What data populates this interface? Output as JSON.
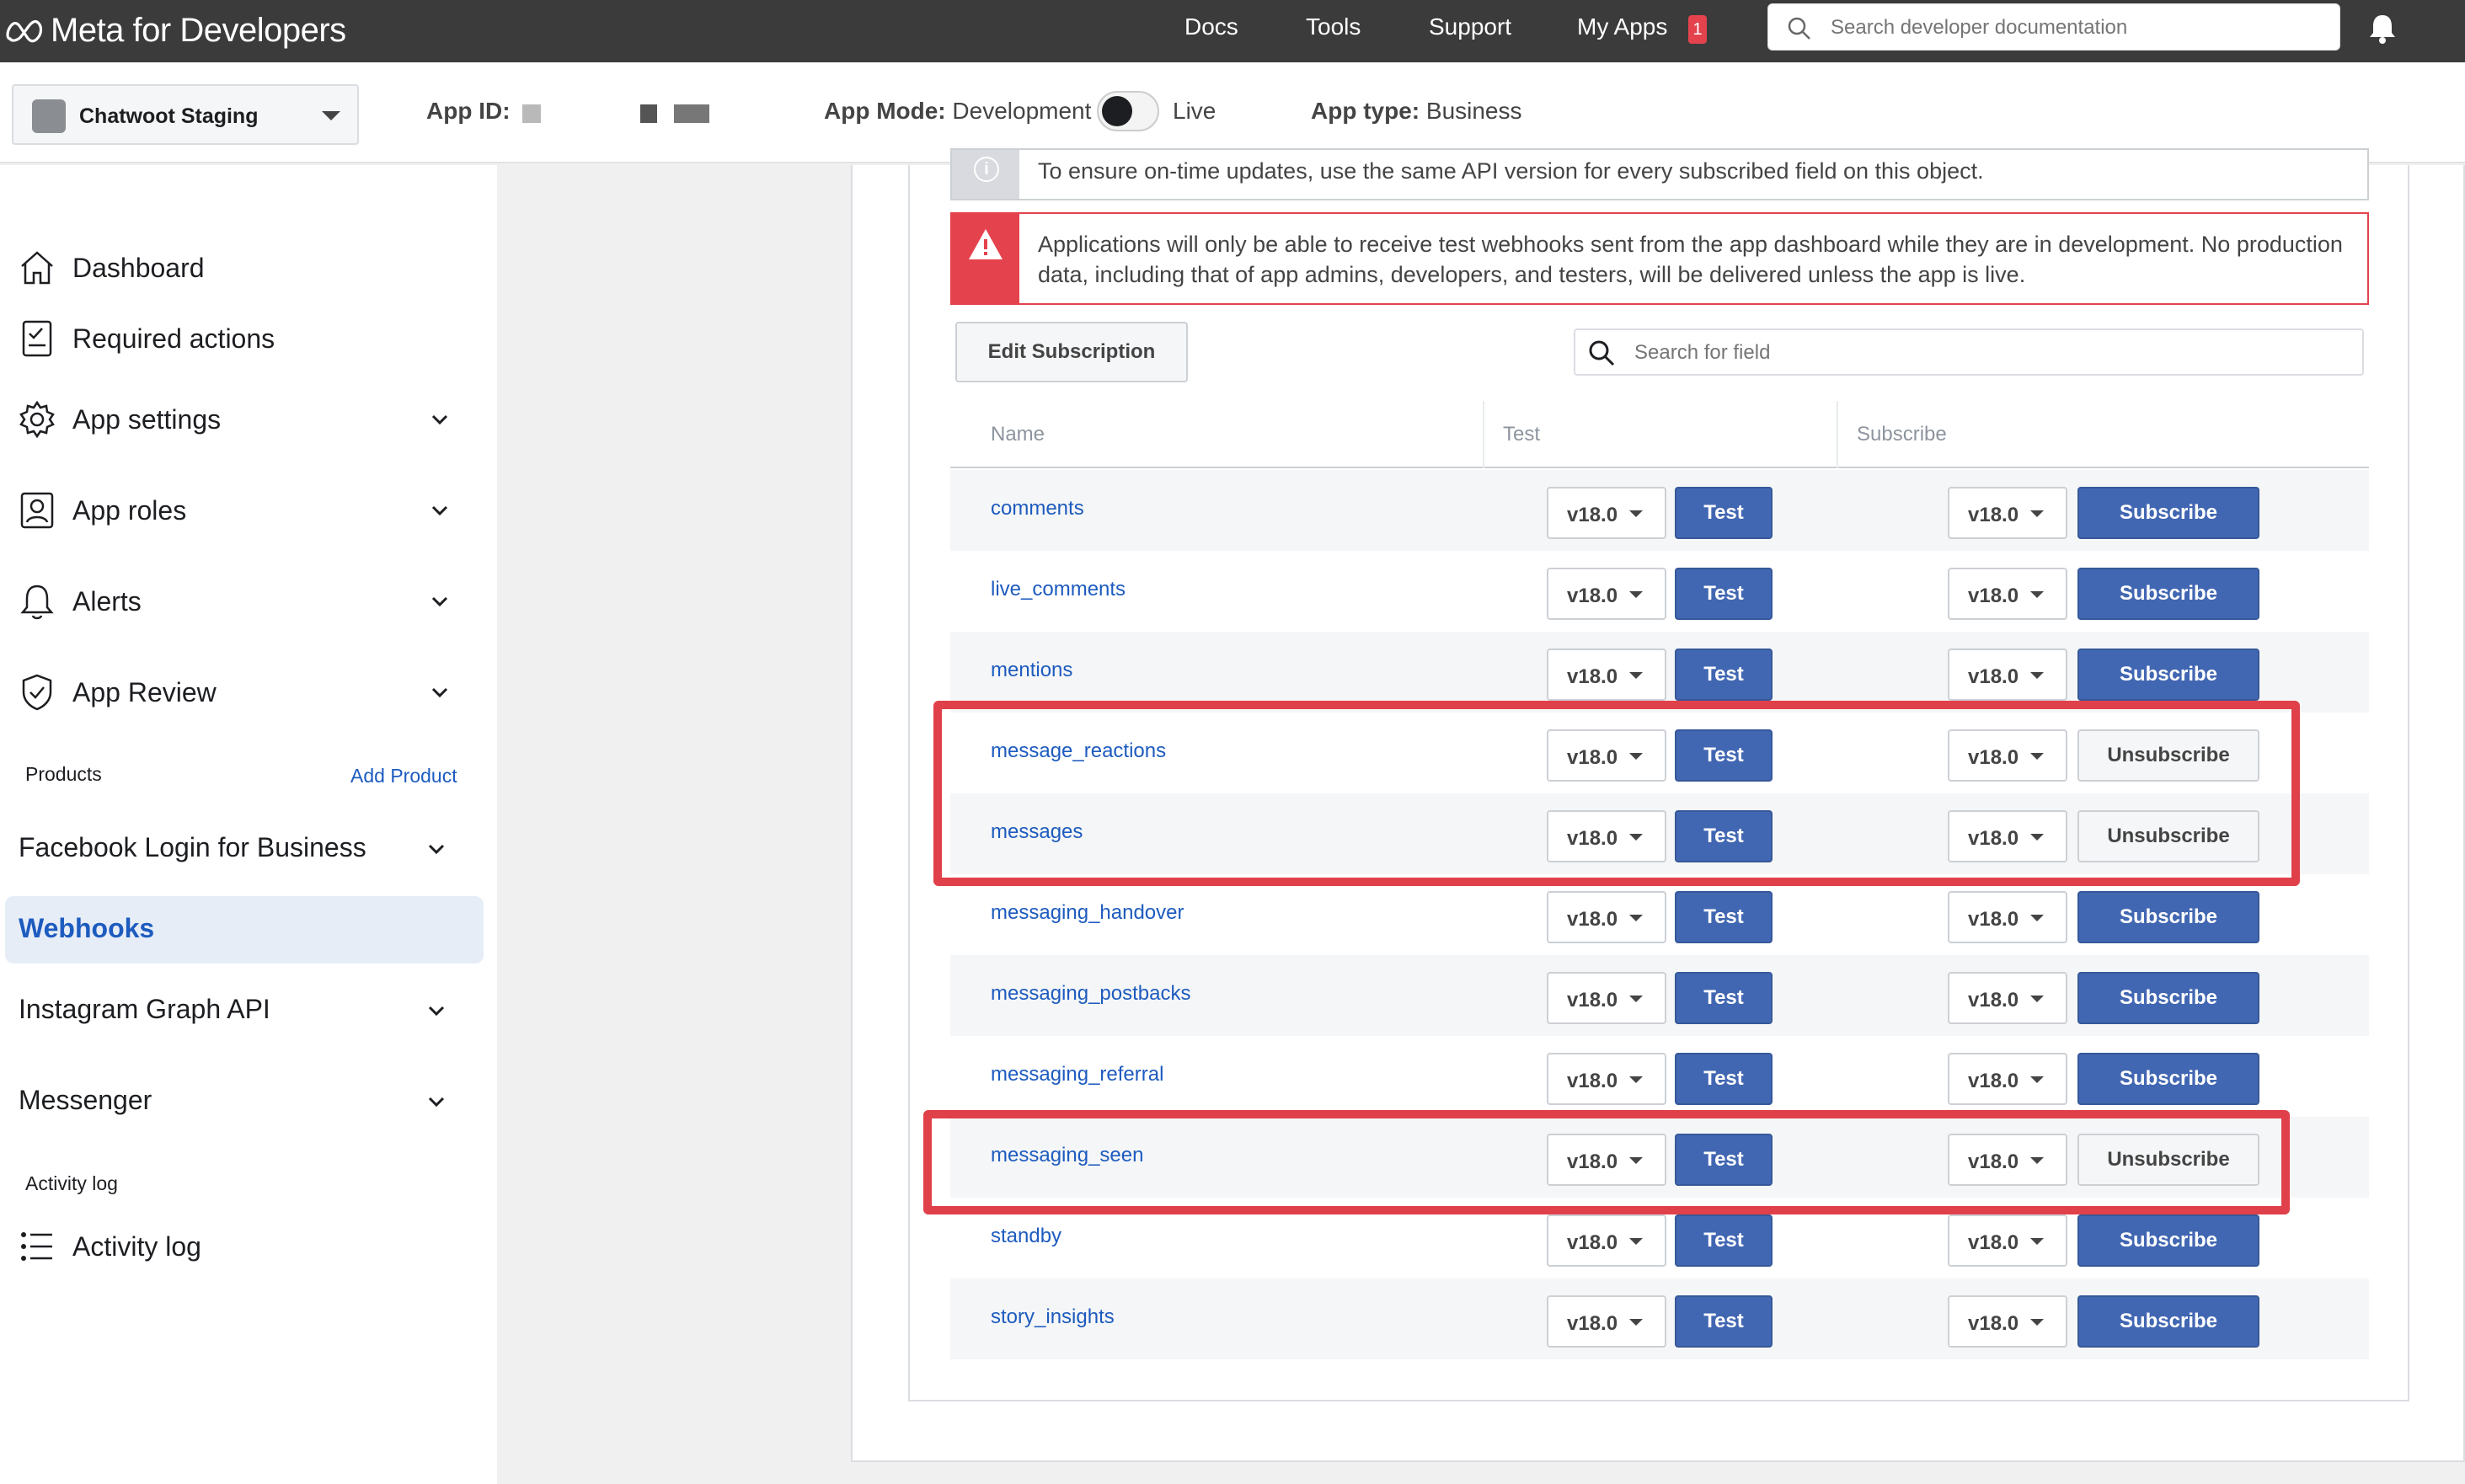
{
  "topnav": {
    "brand": "Meta for Developers",
    "links": [
      "Docs",
      "Tools",
      "Support",
      "My Apps"
    ],
    "my_apps_badge": "1",
    "search_placeholder": "Search developer documentation"
  },
  "header": {
    "app_name": "Chatwoot Staging",
    "app_id_label": "App ID:",
    "app_mode_label": "App Mode:",
    "app_mode_value": "Development",
    "live_label": "Live",
    "app_type_label": "App type:",
    "app_type_value": "Business"
  },
  "sidebar": {
    "items": [
      {
        "label": "Dashboard",
        "icon": "home-icon"
      },
      {
        "label": "Required actions",
        "icon": "checklist-icon"
      },
      {
        "label": "App settings",
        "icon": "gear-icon"
      },
      {
        "label": "App roles",
        "icon": "person-badge-icon"
      },
      {
        "label": "Alerts",
        "icon": "bell-icon"
      },
      {
        "label": "App Review",
        "icon": "shield-check-icon"
      }
    ],
    "products_heading": "Products",
    "add_product": "Add Product",
    "products": [
      {
        "label": "Facebook Login for Business"
      },
      {
        "label": "Webhooks"
      },
      {
        "label": "Instagram Graph API"
      },
      {
        "label": "Messenger"
      }
    ],
    "activity_heading": "Activity log",
    "activity_item": "Activity log"
  },
  "main": {
    "info_text": "To ensure on-time updates, use the same API version for every subscribed field on this object.",
    "warning_text": "Applications will only be able to receive test webhooks sent from the app dashboard while they are in development. No production data, including that of app admins, developers, and testers, will be delivered unless the app is live.",
    "edit_subscription": "Edit Subscription",
    "field_search_placeholder": "Search for field",
    "columns": [
      "Name",
      "Test",
      "Subscribe"
    ],
    "rows": [
      {
        "name": "comments",
        "test_version": "v18.0",
        "test_label": "Test",
        "sub_version": "v18.0",
        "sub_label": "Subscribe"
      },
      {
        "name": "live_comments",
        "test_version": "v18.0",
        "test_label": "Test",
        "sub_version": "v18.0",
        "sub_label": "Subscribe"
      },
      {
        "name": "mentions",
        "test_version": "v18.0",
        "test_label": "Test",
        "sub_version": "v18.0",
        "sub_label": "Subscribe"
      },
      {
        "name": "message_reactions",
        "test_version": "v18.0",
        "test_label": "Test",
        "sub_version": "v18.0",
        "sub_label": "Unsubscribe"
      },
      {
        "name": "messages",
        "test_version": "v18.0",
        "test_label": "Test",
        "sub_version": "v18.0",
        "sub_label": "Unsubscribe"
      },
      {
        "name": "messaging_handover",
        "test_version": "v18.0",
        "test_label": "Test",
        "sub_version": "v18.0",
        "sub_label": "Subscribe"
      },
      {
        "name": "messaging_postbacks",
        "test_version": "v18.0",
        "test_label": "Test",
        "sub_version": "v18.0",
        "sub_label": "Subscribe"
      },
      {
        "name": "messaging_referral",
        "test_version": "v18.0",
        "test_label": "Test",
        "sub_version": "v18.0",
        "sub_label": "Subscribe"
      },
      {
        "name": "messaging_seen",
        "test_version": "v18.0",
        "test_label": "Test",
        "sub_version": "v18.0",
        "sub_label": "Unsubscribe"
      },
      {
        "name": "standby",
        "test_version": "v18.0",
        "test_label": "Test",
        "sub_version": "v18.0",
        "sub_label": "Subscribe"
      },
      {
        "name": "story_insights",
        "test_version": "v18.0",
        "test_label": "Test",
        "sub_version": "v18.0",
        "sub_label": "Subscribe"
      }
    ]
  },
  "colors": {
    "primary": "#4267b2",
    "highlight": "#e0404a",
    "link": "#1d5bbf"
  }
}
